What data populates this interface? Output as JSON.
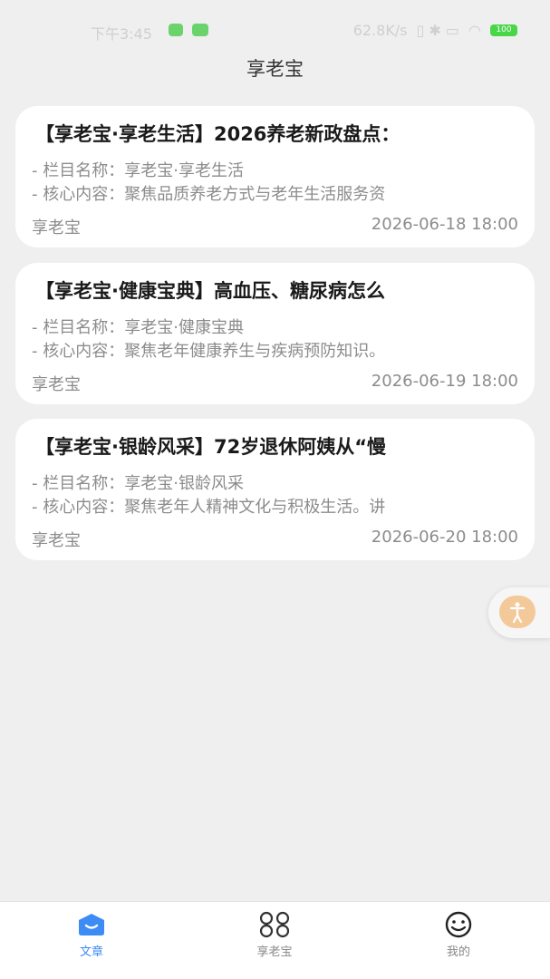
{
  "status": {
    "time": "下午3:45",
    "speed": "62.8K/s",
    "battery": "100"
  },
  "header": {
    "title": "享老宝"
  },
  "articles": [
    {
      "title": "【享老宝·享老生活】2026养老新政盘点：",
      "column_label": "- 栏目名称：",
      "column": "享老宝·享老生活",
      "content_label": "- 核心内容：",
      "content": "聚焦品质养老方式与老年生活服务资",
      "author": "享老宝",
      "date": "2026-06-18 18:00"
    },
    {
      "title": "【享老宝·健康宝典】高血压、糖尿病怎么",
      "column_label": "- 栏目名称：",
      "column": "享老宝·健康宝典",
      "content_label": "- 核心内容：",
      "content": "聚焦老年健康养生与疾病预防知识。",
      "author": "享老宝",
      "date": "2026-06-19 18:00"
    },
    {
      "title": "【享老宝·银龄风采】72岁退休阿姨从“慢",
      "column_label": "- 栏目名称：",
      "column": "享老宝·银龄风采",
      "content_label": "- 核心内容：",
      "content": "聚焦老年人精神文化与积极生活。讲",
      "author": "享老宝",
      "date": "2026-06-20 18:00"
    }
  ],
  "float_button": {
    "icon": "accessibility-icon",
    "color": "#f3c99a"
  },
  "tabbar": {
    "tabs": [
      {
        "label": "文章",
        "icon": "article-icon",
        "active": true
      },
      {
        "label": "享老宝",
        "icon": "grid-icon",
        "active": false
      },
      {
        "label": "我的",
        "icon": "smiley-icon",
        "active": false
      }
    ],
    "active_color": "#3d8cf5"
  }
}
